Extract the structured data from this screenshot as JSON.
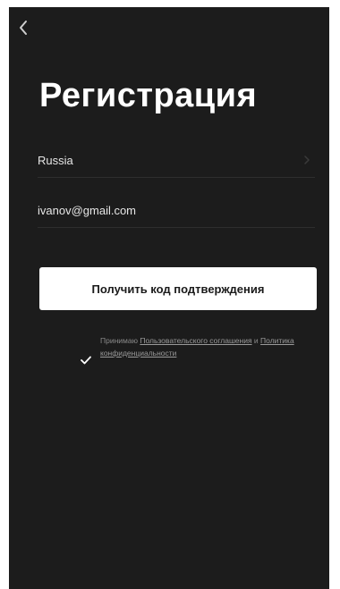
{
  "header": {
    "back_icon": "chevron-left-icon"
  },
  "page": {
    "title": "Регистрация"
  },
  "form": {
    "country_value": "Russia",
    "country_chevron_icon": "chevron-right-icon",
    "email_value": "ivanov@gmail.com",
    "submit_label": "Получить код подтверждения"
  },
  "consent": {
    "checked": true,
    "check_icon": "checkmark-icon",
    "text_prefix": "Принимаю ",
    "terms_link": "Пользовательского соглашения",
    "text_middle": " и ",
    "privacy_link": "Политика конфиденциальности"
  },
  "colors": {
    "background": "#1c1c1c",
    "text": "#ffffff",
    "button": "#ffffff",
    "muted": "#8a8a8a"
  }
}
